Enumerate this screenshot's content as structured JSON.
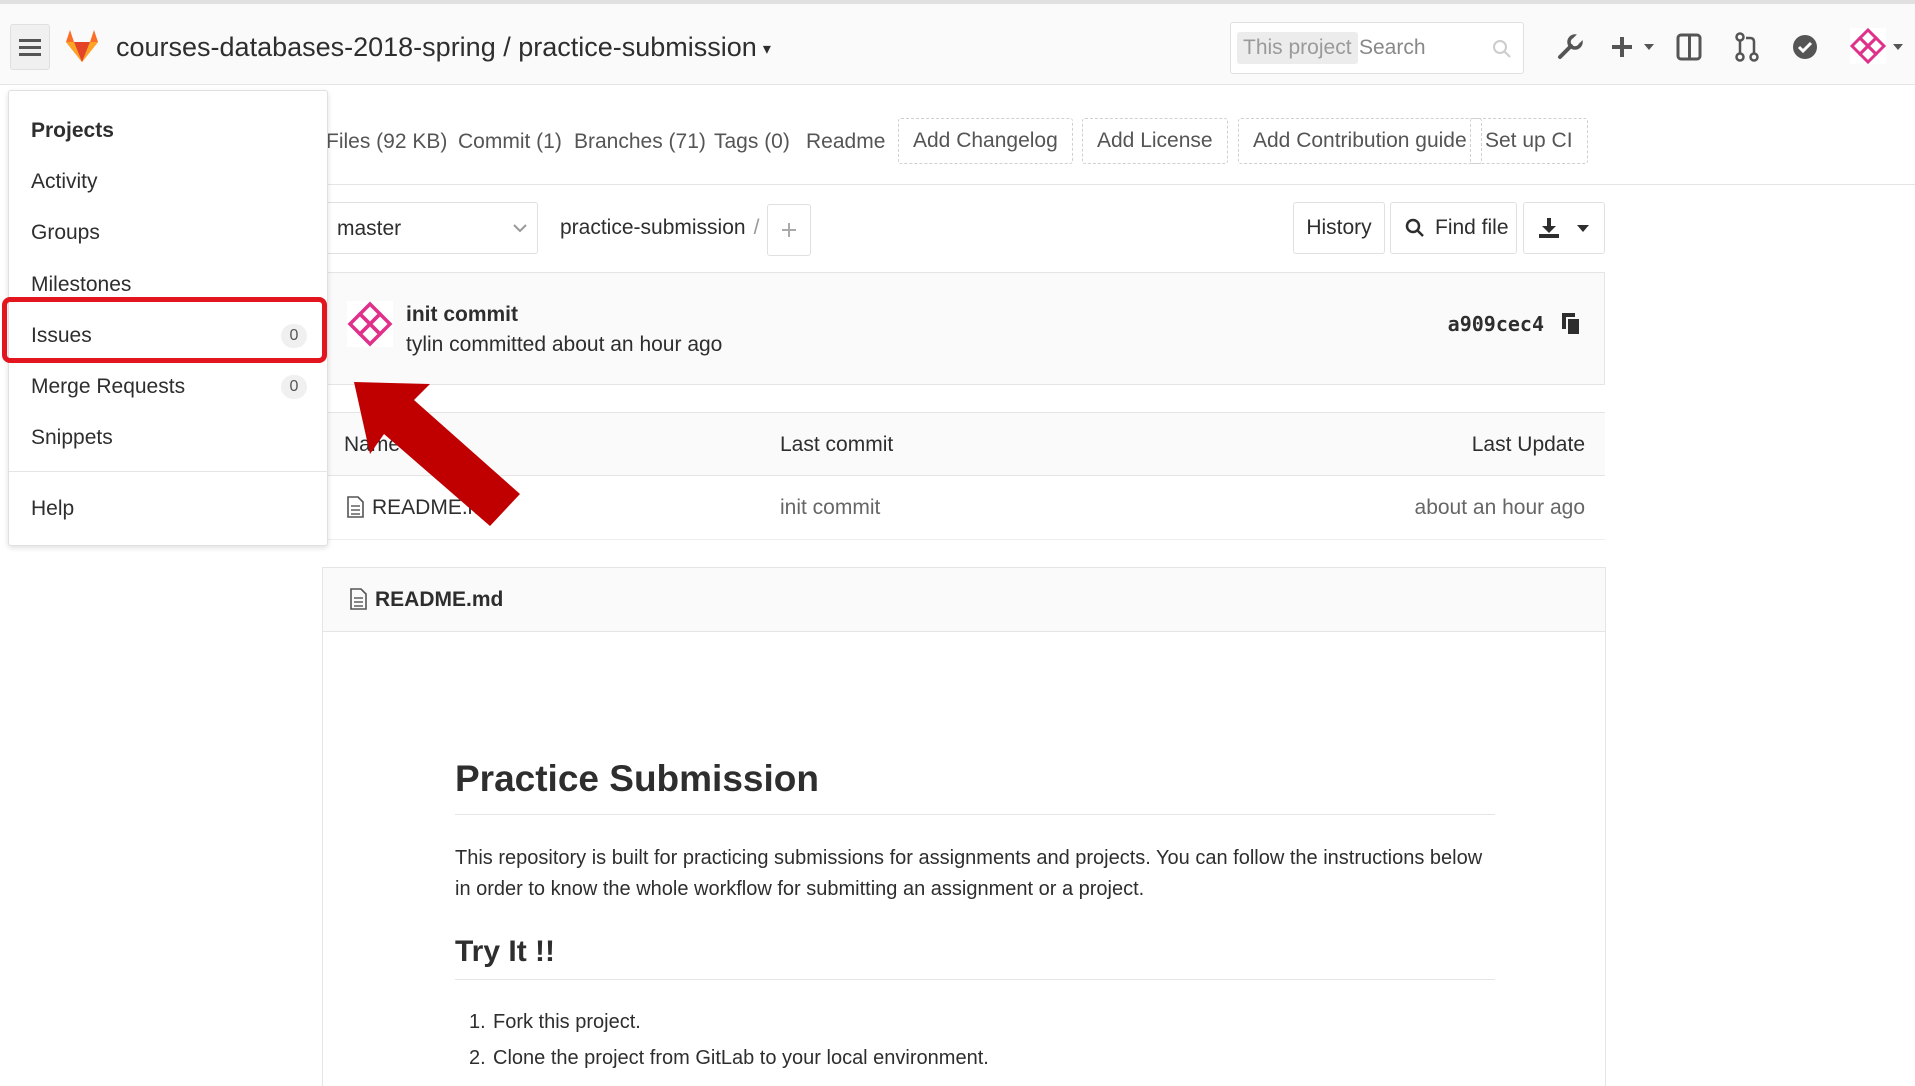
{
  "navbar": {
    "title": "courses-databases-2018-spring / practice-submission",
    "search_scope": "This project",
    "search_placeholder": "Search"
  },
  "subnav": {
    "stats": [
      "Files (92 KB)",
      "Commit (1)",
      "Branches (71)",
      "Tags (0)",
      "Readme"
    ],
    "buttons": [
      "Add Changelog",
      "Add License",
      "Add Contribution guide",
      "Set up CI"
    ]
  },
  "tree": {
    "branch": "master",
    "path": "practice-submission",
    "path_sep": "/",
    "history_label": "History",
    "find_file_label": "Find file"
  },
  "commit": {
    "title": "init commit",
    "meta": "tylin committed about an hour ago",
    "sha": "a909cec4"
  },
  "file_table": {
    "headers": [
      "Name",
      "Last commit",
      "Last Update"
    ],
    "rows": [
      {
        "name": "README.md",
        "last_commit": "init commit",
        "last_update": "about an hour ago"
      }
    ]
  },
  "readme": {
    "filename": "README.md",
    "h1": "Practice Submission",
    "paragraph": "This repository is built for practicing submissions for assignments and projects. You can follow the instructions below in order to know the whole workflow for submitting an assignment or a project.",
    "h2": "Try It !!",
    "steps": [
      {
        "num": "1.",
        "text": "Fork this project."
      },
      {
        "num": "2.",
        "text": "Clone the project from GitLab to your local environment."
      }
    ]
  },
  "dropdown": {
    "header": "Projects",
    "items": [
      {
        "label": "Activity"
      },
      {
        "label": "Groups"
      },
      {
        "label": "Milestones"
      },
      {
        "label": "Issues",
        "badge": "0"
      },
      {
        "label": "Merge Requests",
        "badge": "0"
      },
      {
        "label": "Snippets"
      }
    ],
    "help": "Help"
  },
  "colors": {
    "highlight": "#e3151e",
    "arrow": "#c00000",
    "gitlab_orange": "#fc6d26",
    "avatar": "#e0318a"
  },
  "icons": [
    "hamburger-icon",
    "gitlab-logo-icon",
    "search-icon",
    "wrench-icon",
    "plus-icon",
    "sidebar-icon",
    "merge-request-icon",
    "todo-check-icon",
    "avatar-icon",
    "file-icon",
    "copy-icon",
    "download-icon"
  ]
}
